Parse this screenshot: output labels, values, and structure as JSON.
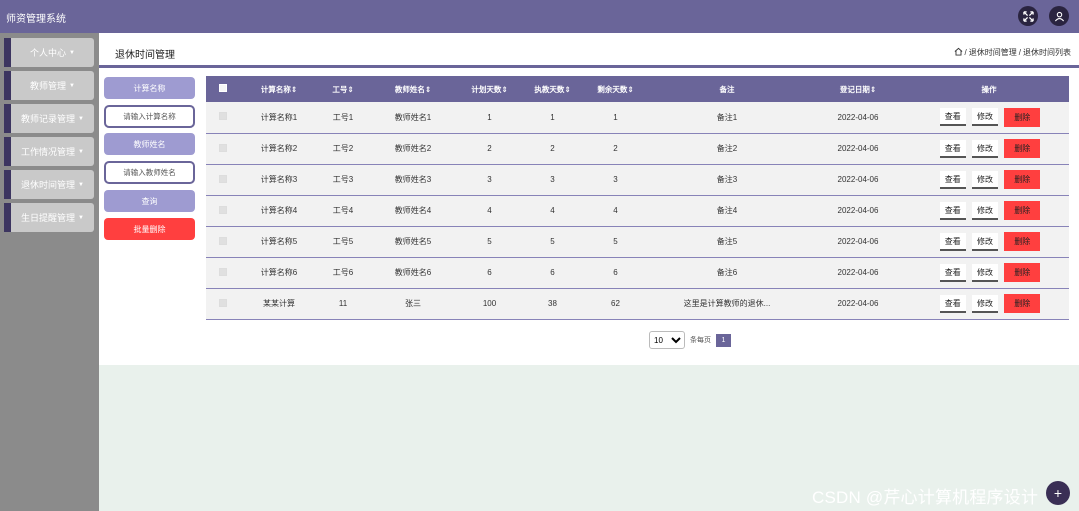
{
  "header": {
    "title": "师资管理系统"
  },
  "sidebar": {
    "items": [
      {
        "label": "个人中心"
      },
      {
        "label": "教师管理"
      },
      {
        "label": "教师记录管理"
      },
      {
        "label": "工作情况管理"
      },
      {
        "label": "退休时间管理"
      },
      {
        "label": "生日提醒管理"
      }
    ]
  },
  "page": {
    "title": "退休时间管理",
    "breadcrumb": {
      "sep": "/",
      "level1": "退休时间管理",
      "level2": "退休时间列表"
    }
  },
  "search": {
    "label1": "计算名称",
    "placeholder1": "请输入计算名称",
    "label2": "教师姓名",
    "placeholder2": "请输入教师姓名",
    "query": "查询",
    "batch_delete": "批量删除"
  },
  "table": {
    "columns": [
      "计算名称",
      "工号",
      "教师姓名",
      "计划天数",
      "执教天数",
      "剩余天数",
      "备注",
      "登记日期",
      "操作"
    ],
    "sort_mark": "⇕",
    "actions": {
      "view": "查看",
      "edit": "修改",
      "delete": "删除"
    },
    "rows": [
      [
        "计算名称1",
        "工号1",
        "教师姓名1",
        "1",
        "1",
        "1",
        "备注1",
        "2022-04-06"
      ],
      [
        "计算名称2",
        "工号2",
        "教师姓名2",
        "2",
        "2",
        "2",
        "备注2",
        "2022-04-06"
      ],
      [
        "计算名称3",
        "工号3",
        "教师姓名3",
        "3",
        "3",
        "3",
        "备注3",
        "2022-04-06"
      ],
      [
        "计算名称4",
        "工号4",
        "教师姓名4",
        "4",
        "4",
        "4",
        "备注4",
        "2022-04-06"
      ],
      [
        "计算名称5",
        "工号5",
        "教师姓名5",
        "5",
        "5",
        "5",
        "备注5",
        "2022-04-06"
      ],
      [
        "计算名称6",
        "工号6",
        "教师姓名6",
        "6",
        "6",
        "6",
        "备注6",
        "2022-04-06"
      ],
      [
        "某某计算",
        "11",
        "张三",
        "100",
        "38",
        "62",
        "这里是计算教师的退休...",
        "2022-04-06"
      ]
    ]
  },
  "pagination": {
    "page_size": "10",
    "per_page_label": "条每页",
    "current_page": "1"
  },
  "watermark": "CSDN @芹心计算机程序设计",
  "colors": {
    "primary": "#6a6599",
    "label": "#9e9bd1",
    "danger": "#ff3f3f",
    "sidebar": "#8b8b8b"
  }
}
